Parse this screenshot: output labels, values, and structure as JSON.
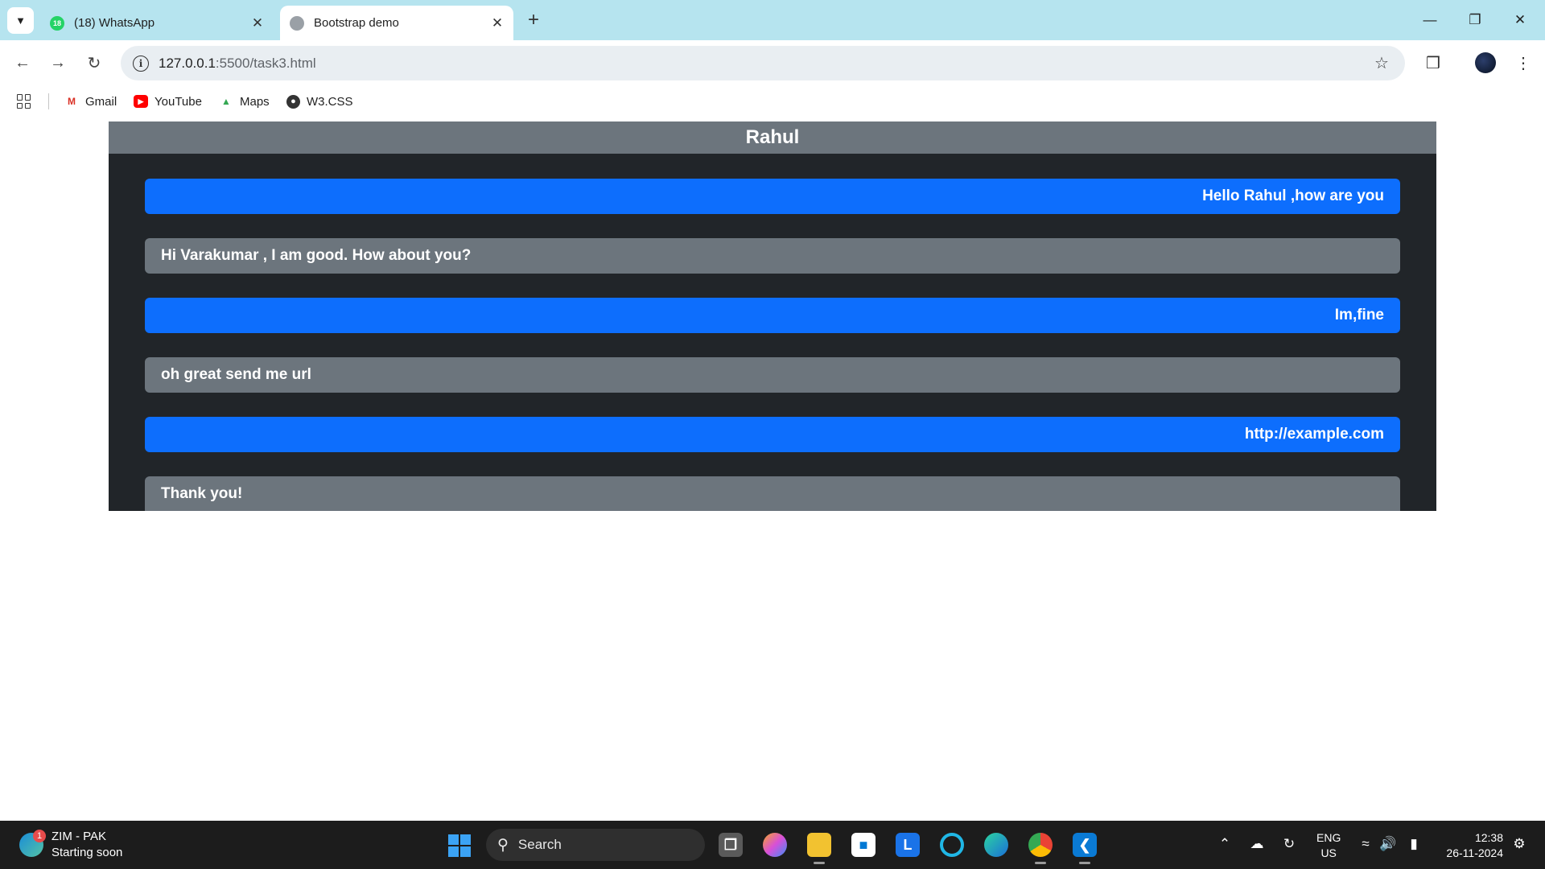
{
  "browser": {
    "tabs": [
      {
        "title": "(18) WhatsApp",
        "badge": "18",
        "active": false
      },
      {
        "title": "Bootstrap demo",
        "active": true
      }
    ],
    "url_host": "127.0.0.1",
    "url_path": ":5500/task3.html",
    "bookmarks": [
      {
        "label": "Gmail",
        "icon": "gmail-icon"
      },
      {
        "label": "YouTube",
        "icon": "youtube-icon"
      },
      {
        "label": "Maps",
        "icon": "maps-icon"
      },
      {
        "label": "W3.CSS",
        "icon": "globe-icon"
      }
    ]
  },
  "chat": {
    "header": "Rahul",
    "messages": [
      {
        "text": "Hello Rahul ,how are you",
        "side": "sent"
      },
      {
        "text": "Hi Varakumar , I am good. How about you?",
        "side": "received"
      },
      {
        "text": "Im,fine",
        "side": "sent"
      },
      {
        "text": "oh great send me url",
        "side": "received"
      },
      {
        "text": "http://example.com",
        "side": "sent"
      },
      {
        "text": "Thank you!",
        "side": "received"
      }
    ]
  },
  "taskbar": {
    "weather_title": "ZIM - PAK",
    "weather_sub": "Starting soon",
    "weather_badge": "1",
    "search_label": "Search",
    "lang_1": "ENG",
    "lang_2": "US",
    "time": "12:38",
    "date": "26-11-2024"
  },
  "colors": {
    "sent": "#0d6efd",
    "received": "#6c757d",
    "card": "#212529"
  }
}
